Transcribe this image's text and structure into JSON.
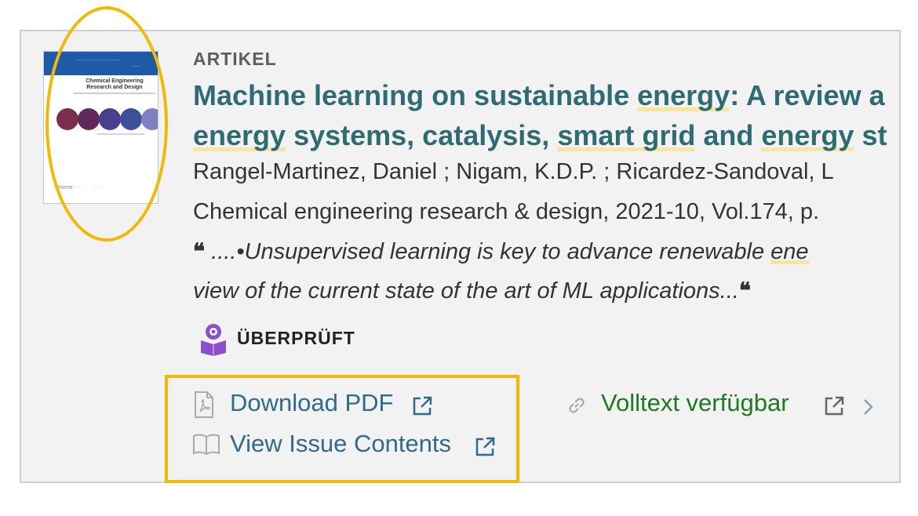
{
  "result": {
    "type_label": "ARTIKEL",
    "title_line1_a": "Machine learning on sustainable ",
    "title_line1_hl": "energy",
    "title_line1_b": ": A review a",
    "title_line2_hl1": "energy",
    "title_line2_a": " systems, catalysis, ",
    "title_line2_hl2": "smart grid",
    "title_line2_b": " and ",
    "title_line2_hl3": "energy",
    "title_line2_c": " st",
    "authors": "Rangel-Martinez, Daniel ; Nigam, K.D.P. ; Ricardez-Sandoval, L",
    "source": "Chemical engineering research & design, 2021-10, Vol.174, p.",
    "snippet_line1": "....•Unsupervised learning is key to advance renewable ",
    "snippet_line1_hl": "ene",
    "snippet_line2": "view of the current state of the art of ML applications...",
    "peer_reviewed_label": "ÜBERPRÜFT",
    "thumbnail": {
      "journal_title": "Chemical Engineering Research and Design",
      "icon": "journal-cover-image"
    }
  },
  "links": {
    "download_pdf": "Download PDF",
    "view_issue": "View Issue Contents",
    "fulltext_available": "Volltext verfügbar"
  },
  "colors": {
    "highlight_box": "#f5b800",
    "title": "#2f6b72",
    "link": "#2f6b8a",
    "available": "#1f7a1f",
    "peer_icon": "#8a4fc9"
  }
}
